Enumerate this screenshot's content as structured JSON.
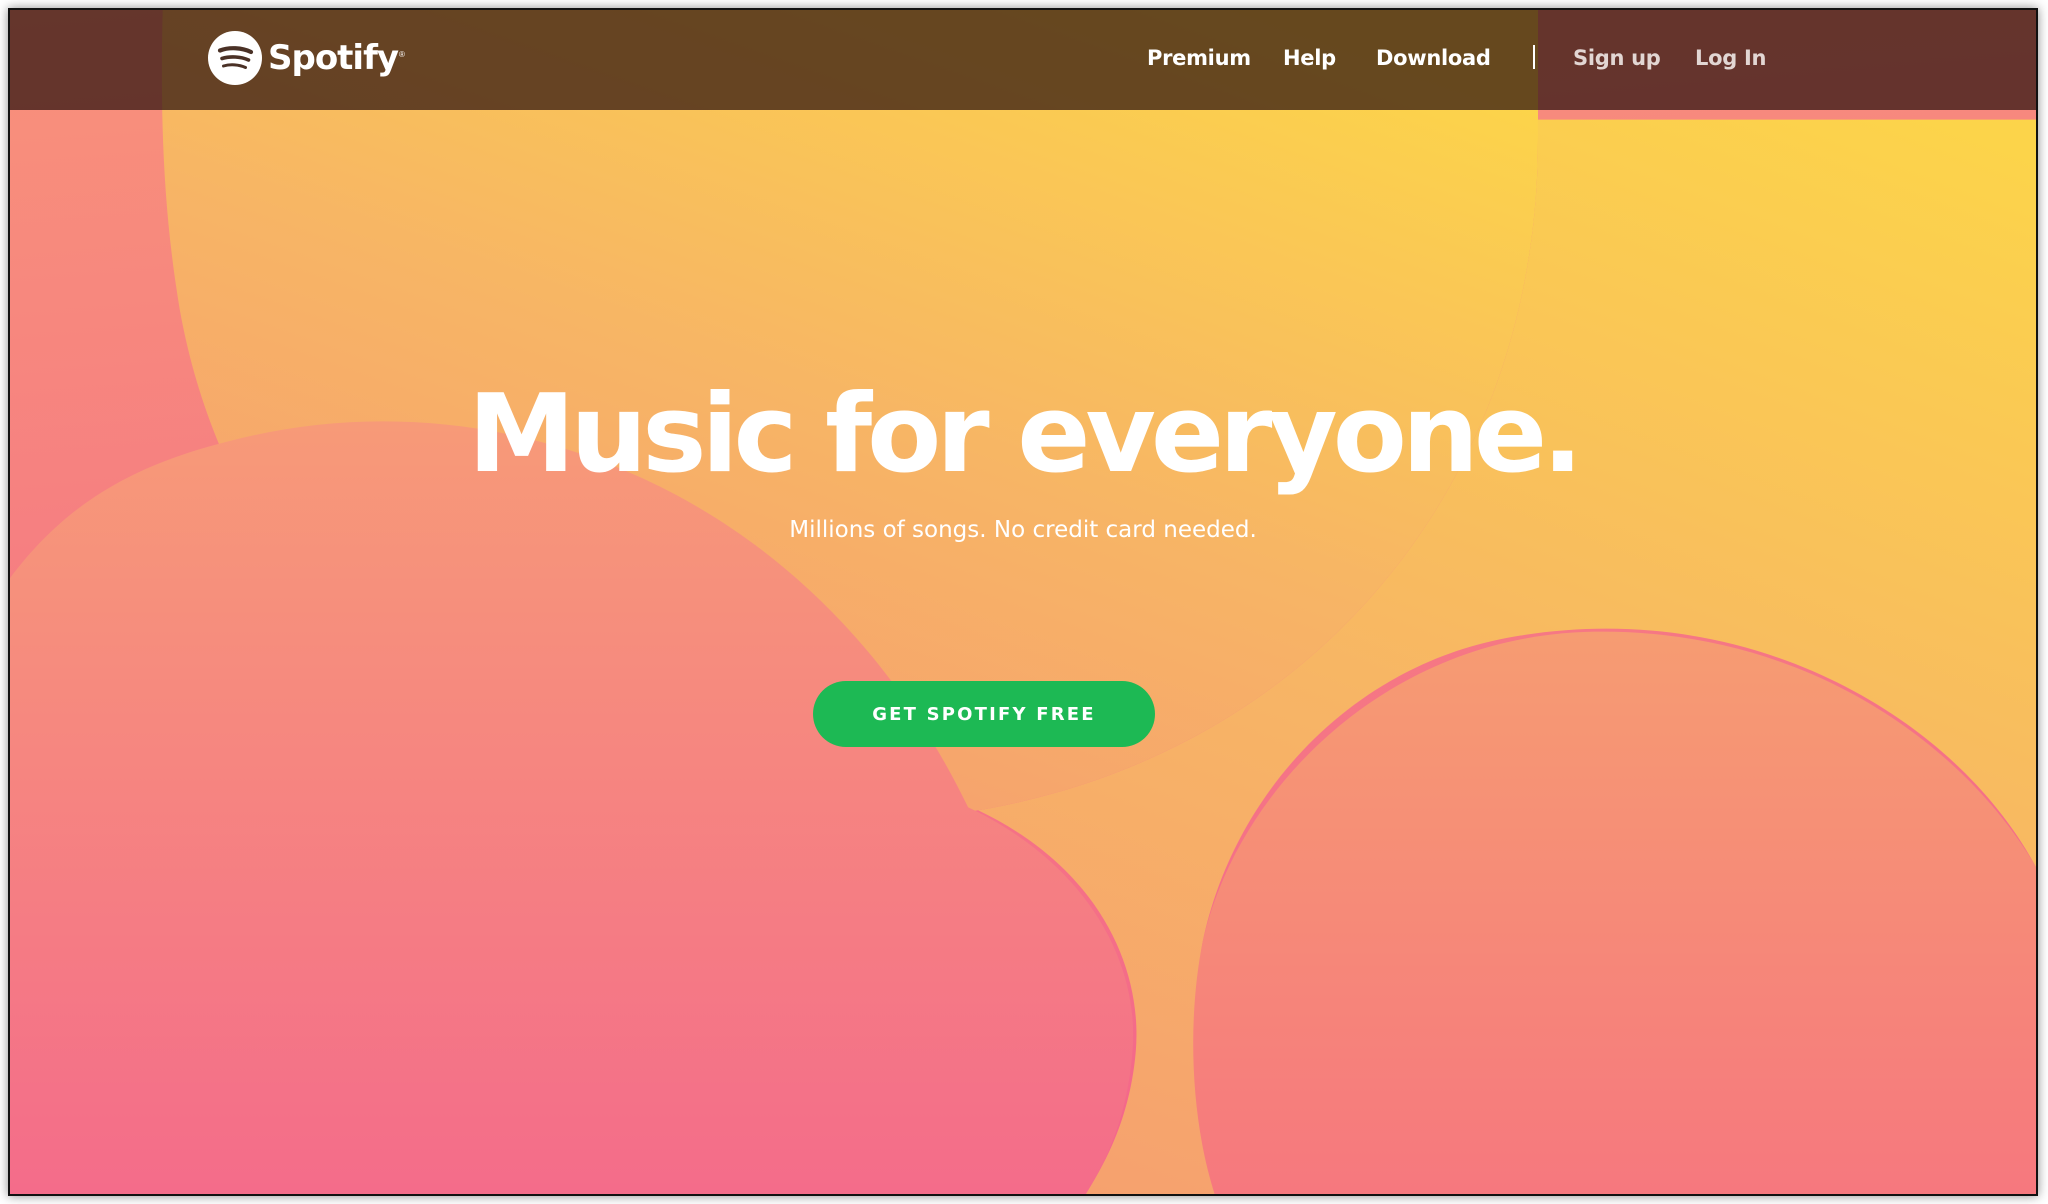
{
  "brand": {
    "name": "Spotify",
    "reg_mark": "®",
    "icon": "spotify-logo-icon",
    "accent_color": "#1db954"
  },
  "nav": {
    "items": [
      {
        "label": "Premium"
      },
      {
        "label": "Help"
      },
      {
        "label": "Download"
      },
      {
        "label": "Sign up"
      },
      {
        "label": "Log In"
      }
    ]
  },
  "hero": {
    "title": "Music for everyone.",
    "subtitle": "Millions of songs. No credit card needed.",
    "cta_label": "GET SPOTIFY FREE",
    "background_colors": {
      "top": "#f8a07a",
      "bottom": "#f4668a",
      "shape": "#fbd14b"
    }
  }
}
